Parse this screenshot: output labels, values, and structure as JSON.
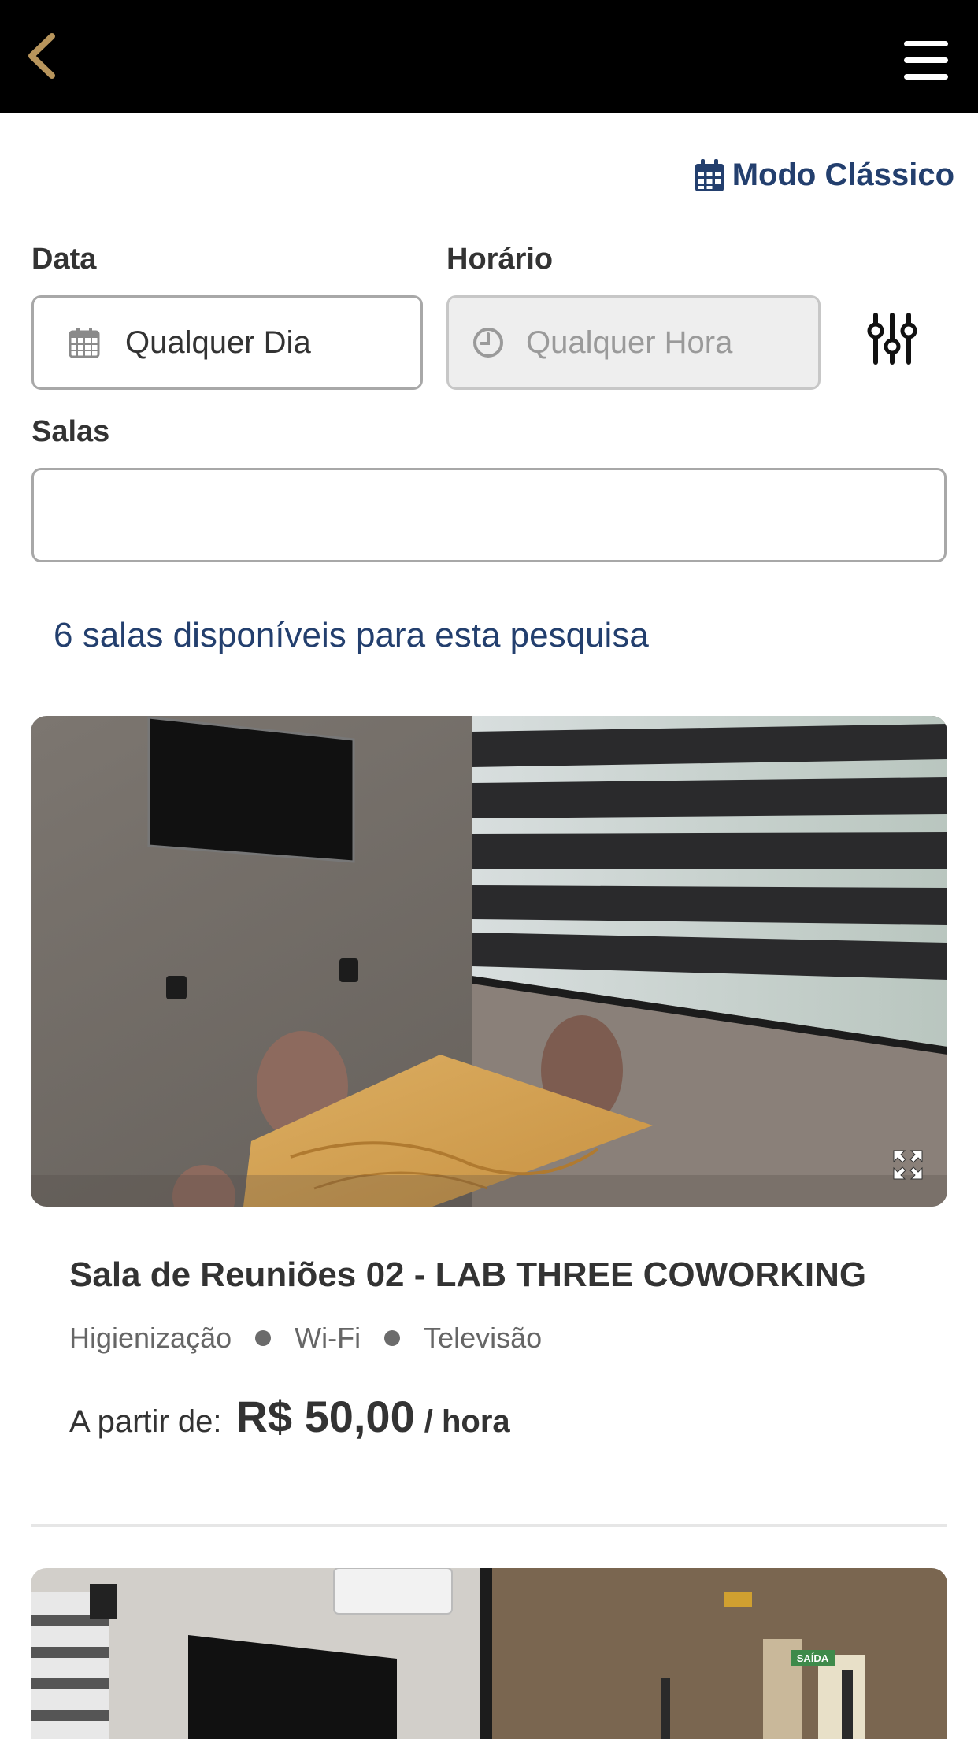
{
  "header": {
    "back_icon": "chevron-left-icon",
    "menu_icon": "hamburger-menu-icon",
    "accent_color": "#b8955c",
    "background_color": "#000000"
  },
  "mode_toggle": {
    "icon": "calendar-icon",
    "label": "Modo Clássico",
    "color": "#233f6e"
  },
  "filters": {
    "date": {
      "label": "Data",
      "icon": "calendar-icon",
      "value": "Qualquer Dia"
    },
    "time": {
      "label": "Horário",
      "icon": "clock-icon",
      "value": "Qualquer Hora",
      "disabled": true
    },
    "filter_icon": "sliders-icon",
    "rooms": {
      "label": "Salas",
      "value": ""
    }
  },
  "results": {
    "text": "6 salas disponíveis para esta pesquisa"
  },
  "rooms": [
    {
      "title": "Sala de Reuniões 02 - LAB THREE COWORKING",
      "amenities": [
        "Higienização",
        "Wi-Fi",
        "Televisão"
      ],
      "price_prefix": "A partir de:",
      "price": "R$ 50,00",
      "price_unit": "/ hora",
      "expand_icon": "expand-icon"
    },
    {
      "title": "",
      "exit_sign": "SAÍDA"
    }
  ]
}
